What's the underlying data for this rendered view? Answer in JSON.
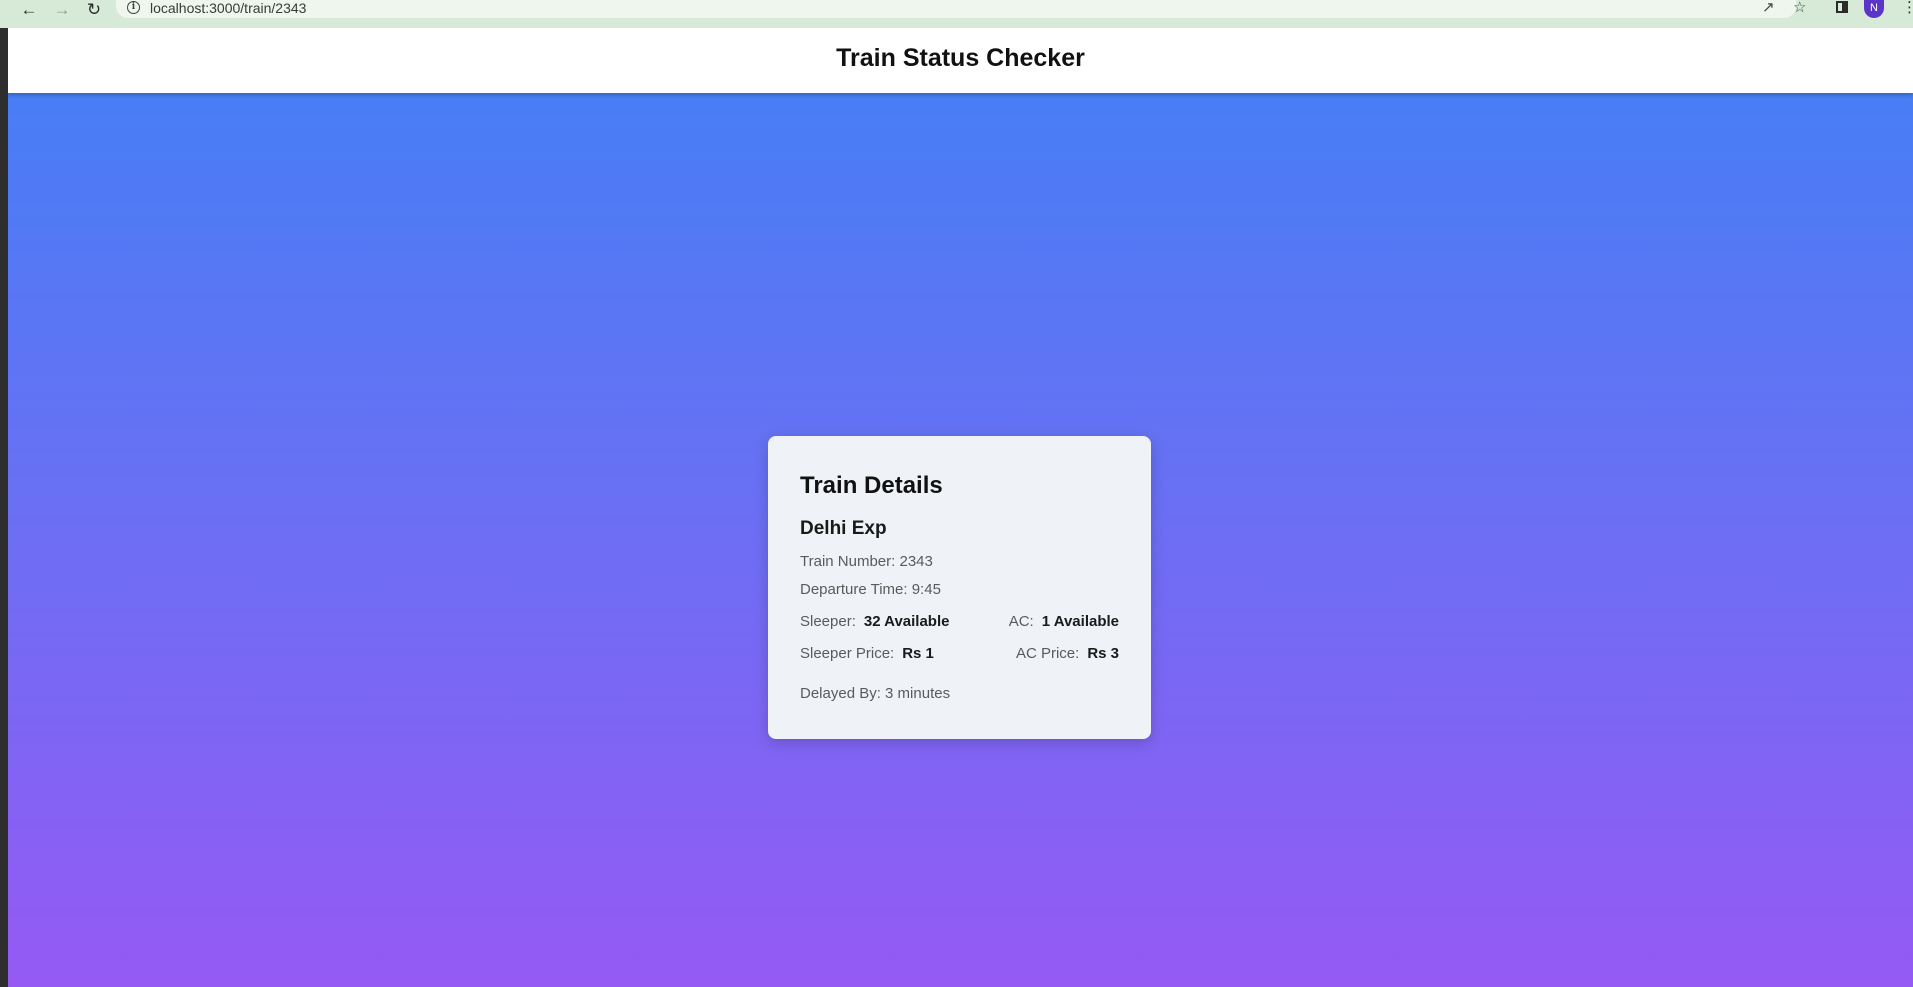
{
  "browser": {
    "back_icon": "arrow-left-icon",
    "forward_icon": "arrow-right-icon",
    "reload_icon": "reload-icon",
    "url": "localhost:3000/train/2343",
    "info_icon": "info-icon",
    "share_icon": "share-icon",
    "bookmark_icon": "star-icon",
    "side_panel_icon": "side-panel-icon",
    "profile_initial": "N",
    "menu_icon": "more-vertical-icon"
  },
  "header": {
    "title": "Train Status Checker"
  },
  "card": {
    "title": "Train Details",
    "train_name": "Delhi Exp",
    "train_number_label": "Train Number:",
    "train_number": "2343",
    "departure_label": "Departure Time:",
    "departure_time": "9:45",
    "sleeper_label": "Sleeper:",
    "sleeper_value": "32 Available",
    "ac_label": "AC:",
    "ac_value": "1 Available",
    "sleeper_price_label": "Sleeper Price:",
    "sleeper_price_value": "Rs 1",
    "ac_price_label": "AC Price:",
    "ac_price_value": "Rs 3",
    "delayed_label": "Delayed By:",
    "delayed_value": "3 minutes"
  },
  "colors": {
    "gradient_top": "#4280f6",
    "gradient_bottom": "#9559f4",
    "card_background": "#eff3f8",
    "header_background": "#ffffff"
  }
}
